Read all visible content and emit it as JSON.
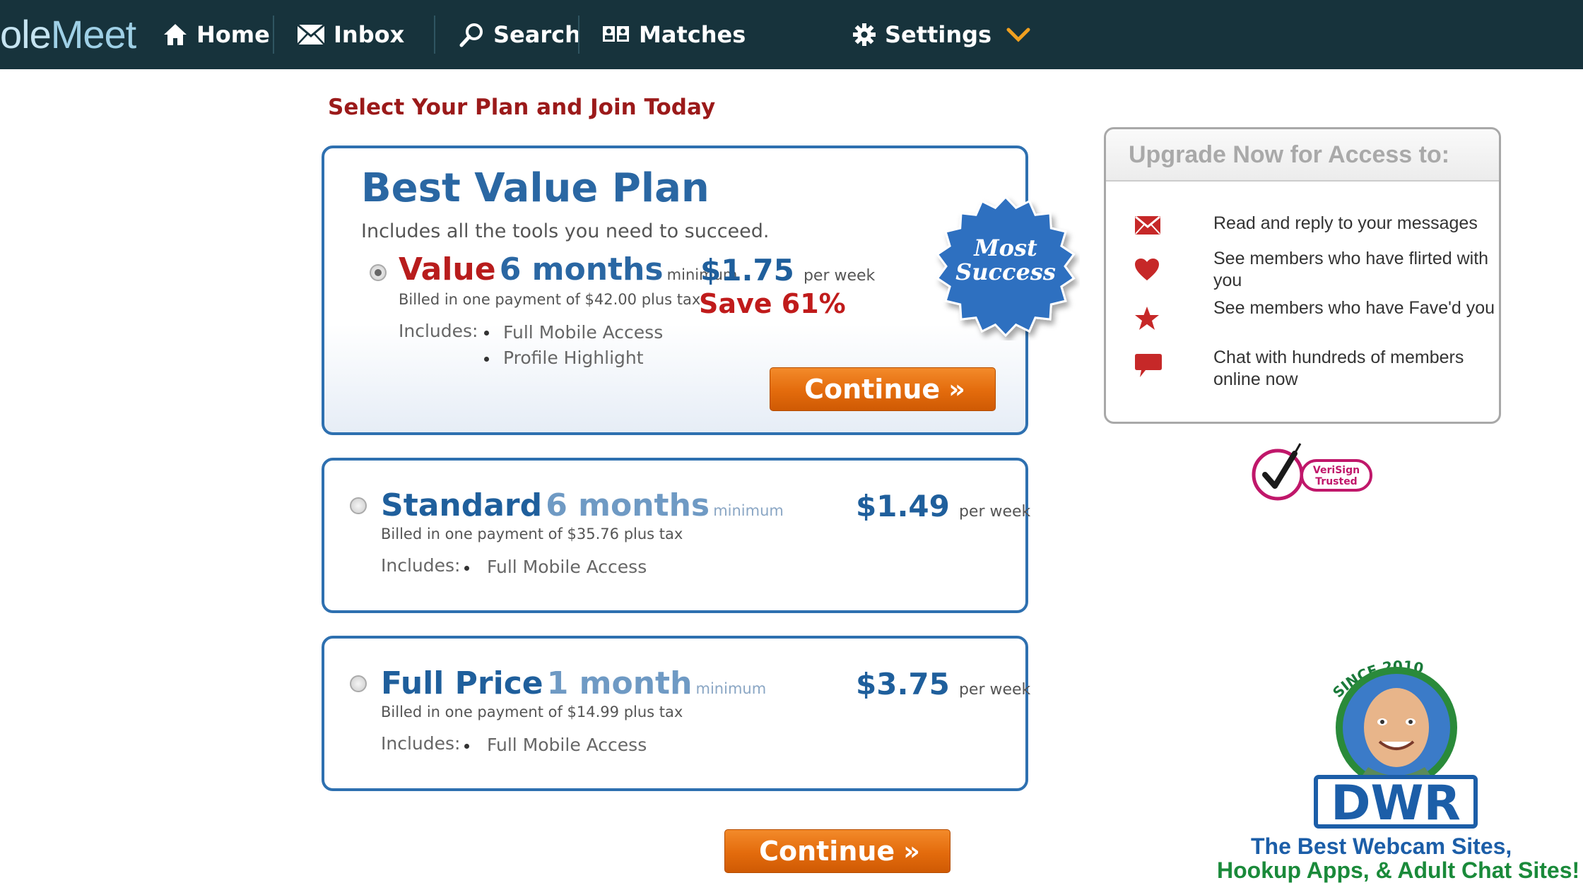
{
  "nav": {
    "brand_part1": "ole",
    "brand_part2": "Meet",
    "items": [
      {
        "label": "Home",
        "icon": "home-icon"
      },
      {
        "label": "Inbox",
        "icon": "envelope-icon"
      },
      {
        "label": "Search",
        "icon": "search-icon"
      },
      {
        "label": "Matches",
        "icon": "matches-icon"
      },
      {
        "label": "Settings",
        "icon": "gear-icon"
      }
    ]
  },
  "main": {
    "title": "Select Your Plan and Join Today",
    "best": {
      "heading": "Best Value Plan",
      "subheading": "Includes all the tools you need to succeed.",
      "name": "Value",
      "duration": "6 months",
      "minimum": "minimum",
      "price": "$1.75",
      "per": "per week",
      "billed": "Billed in one payment of $42.00 plus tax",
      "save": "Save 61%",
      "includes_label": "Includes:",
      "includes": [
        "Full Mobile Access",
        "Profile Highlight"
      ],
      "badge_line1": "Most",
      "badge_line2": "Success",
      "continue": "Continue"
    },
    "standard": {
      "name": "Standard",
      "duration": "6 months",
      "minimum": "minimum",
      "price": "$1.49",
      "per": "per week",
      "billed": "Billed in one payment of $35.76 plus tax",
      "includes_label": "Includes:",
      "includes": [
        "Full Mobile Access"
      ]
    },
    "full": {
      "name": "Full Price",
      "duration": "1 month",
      "minimum": "minimum",
      "price": "$3.75",
      "per": "per week",
      "billed": "Billed in one payment of $14.99 plus tax",
      "includes_label": "Includes:",
      "includes": [
        "Full Mobile Access"
      ]
    },
    "continue_bottom": "Continue"
  },
  "sidebar": {
    "heading": "Upgrade Now for Access to:",
    "features": [
      {
        "icon": "envelope-icon",
        "text": "Read and reply to your messages"
      },
      {
        "icon": "heart-icon",
        "text": "See members who have flirted with you"
      },
      {
        "icon": "star-icon",
        "text": "See members who have Fave'd you"
      },
      {
        "icon": "chat-bubble-icon",
        "text": "Chat with hundreds of members online now"
      }
    ],
    "verisign_line1": "VeriSign",
    "verisign_line2": "Trusted"
  },
  "watermark": {
    "since": "SINCE 2010",
    "logo": "DWR",
    "tagline1": "The Best Webcam Sites,",
    "tagline2": "Hookup Apps, & Adult Chat Sites!"
  },
  "colors": {
    "nav_bg": "#17333c",
    "accent_blue": "#2a67a3",
    "accent_red": "#b81c1c",
    "button_orange": "#e36b0c"
  }
}
